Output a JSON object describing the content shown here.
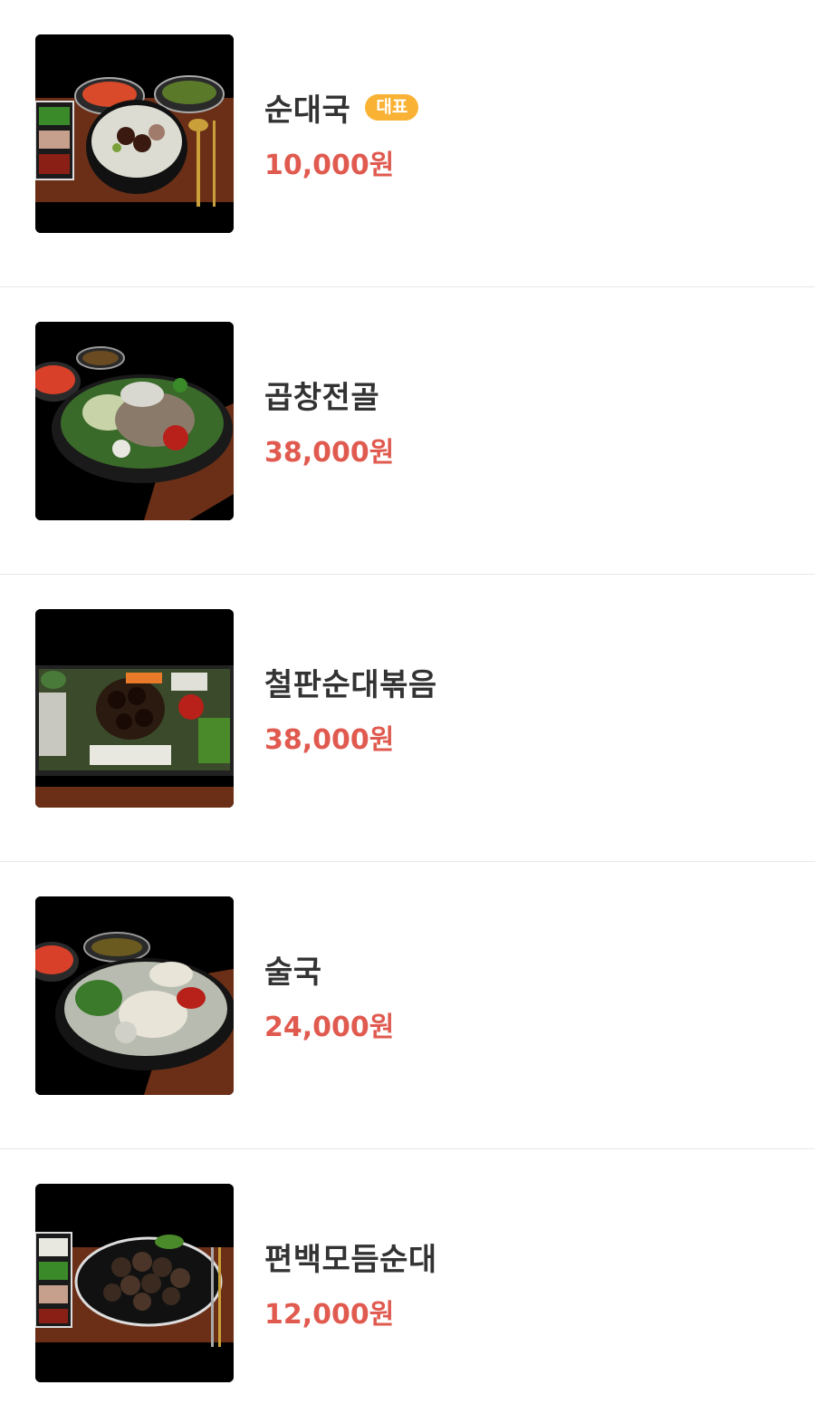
{
  "menu": {
    "items": [
      {
        "name": "순대국",
        "price": "10,000원",
        "badge": "대표",
        "image_icon": "sundaeguk-dish-image"
      },
      {
        "name": "곱창전골",
        "price": "38,000원",
        "badge": "",
        "image_icon": "gopchang-jeongol-dish-image"
      },
      {
        "name": "철판순대볶음",
        "price": "38,000원",
        "badge": "",
        "image_icon": "cheolpan-sundae-bokkeum-dish-image"
      },
      {
        "name": "술국",
        "price": "24,000원",
        "badge": "",
        "image_icon": "sulguk-dish-image"
      },
      {
        "name": "편백모듬순대",
        "price": "12,000원",
        "badge": "",
        "image_icon": "pyeonbaek-modeum-sundae-dish-image"
      }
    ]
  },
  "colors": {
    "badge": "#f9b233",
    "price": "#e05a4f",
    "name": "#333333",
    "divider": "#e8e8e8"
  }
}
